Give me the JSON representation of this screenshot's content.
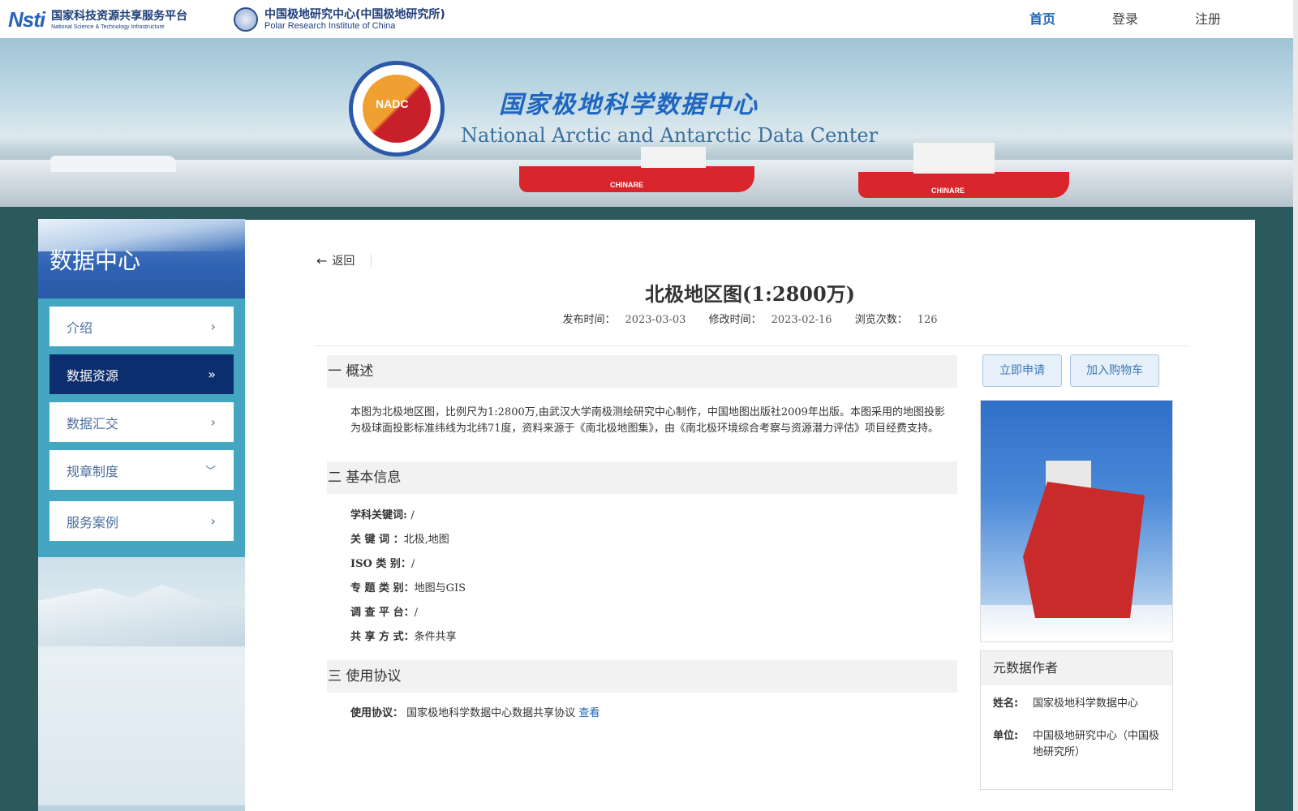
{
  "header": {
    "logo_mark": "Nsti",
    "logo_cn": "国家科技资源共享服务平台",
    "logo_en": "National Science & Technology Infrastructure",
    "pri_cn": "中国极地研究中心(中国极地研究所)",
    "pri_en": "Polar Research Institute of China",
    "nav": [
      "首页",
      "登录",
      "注册"
    ]
  },
  "banner": {
    "seal_text": "NADC",
    "title_cn": "国家极地科学数据中心",
    "title_en": "National Arctic and Antarctic Data Center",
    "ship_label_1": "CHINARE",
    "ship_label_2": "CHINARE"
  },
  "sidebar": {
    "heading": "数据中心",
    "items": [
      {
        "label": "介绍",
        "icon": "chevron-right-icon"
      },
      {
        "label": "数据资源",
        "icon": "double-chevron-right-icon",
        "active": true
      },
      {
        "label": "数据汇交",
        "icon": "chevron-right-icon"
      },
      {
        "label": "规章制度",
        "icon": "chevron-down-icon"
      },
      {
        "label": "服务案例",
        "icon": "chevron-right-icon"
      }
    ]
  },
  "main": {
    "back_label": "返回",
    "title": "北极地区图(1:2800万)",
    "meta": {
      "publish_label": "发布时间：",
      "publish_date": "2023-03-03",
      "modify_label": "修改时间：",
      "modify_date": "2023-02-16",
      "views_label": "浏览次数：",
      "views": "126"
    },
    "sections": {
      "overview": "一 概述",
      "basic": "二 基本信息",
      "agreement": "三  使用协议"
    },
    "overview_text": "本图为北极地区图，比例尺为1:2800万,由武汉大学南极测绘研究中心制作，中国地图出版社2009年出版。本图采用的地图投影为极球面投影标准纬线为北纬71度，资料来源于《南北极地图集》，由《南北极环境综合考察与资源潜力评估》项目经费支持。",
    "basic_info": [
      {
        "key": "学科关键词",
        "sep": ": ",
        "value": "/"
      },
      {
        "key": "关  键  词",
        "sep": " ：",
        "value": "北极,地图"
      },
      {
        "key": "ISO  类  别",
        "sep": "：",
        "value": "/"
      },
      {
        "key": "专 题 类 别",
        "sep": "：",
        "value": "地图与GIS"
      },
      {
        "key": "调 查 平 台",
        "sep": "：",
        "value": "/"
      },
      {
        "key": "共 享 方 式",
        "sep": "：",
        "value": "条件共享"
      }
    ],
    "agreement": {
      "key": "使用协议：",
      "value": "国家极地科学数据中心数据共享协议",
      "link": "查看"
    }
  },
  "aside": {
    "apply_button": "立即申请",
    "cart_button": "加入购物车",
    "author_heading": "元数据作者",
    "name_label": "姓名:",
    "name_value": "国家极地科学数据中心",
    "unit_label": "单位:",
    "unit_value": "中国极地研究中心（中国极地研究所）"
  },
  "colors": {
    "accent": "#1f64b6",
    "sidebar_active": "#0b2e6e",
    "sidebar_menu_bg": "#45a6c2",
    "page_bg": "#2c5a5c"
  }
}
